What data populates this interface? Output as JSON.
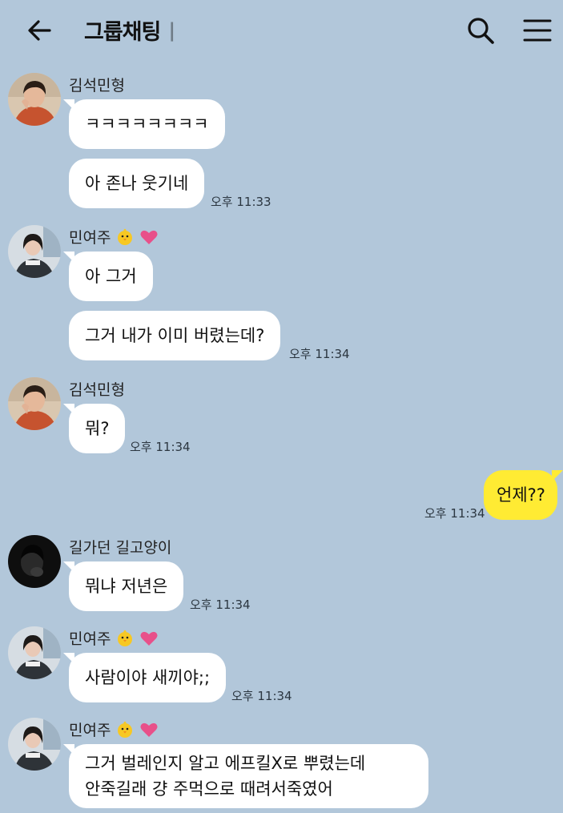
{
  "header": {
    "title": "그룹채팅",
    "count": "|",
    "back_icon": "arrow-left-icon",
    "search_icon": "search-icon",
    "menu_icon": "hamburger-menu-icon"
  },
  "colors": {
    "background": "#b2c7da",
    "incoming_bubble": "#ffffff",
    "outgoing_bubble": "#ffeb33",
    "heart": "#e8508a"
  },
  "messages": [
    {
      "sender": "김석민형",
      "texts": [
        "ㅋㅋㅋㅋㅋㅋㅋㅋ",
        "아 존나 웃기네"
      ],
      "time": "오후 11:33"
    },
    {
      "sender": "민여주",
      "sender_emoji": [
        "chick-icon",
        "heart-icon"
      ],
      "texts": [
        "아 그거",
        "그거 내가 이미 버렸는데?"
      ],
      "time": "오후 11:34"
    },
    {
      "sender": "김석민형",
      "texts": [
        "뭐?"
      ],
      "time": "오후 11:34"
    },
    {
      "sender": "me",
      "texts": [
        "언제??"
      ],
      "time": "오후 11:34"
    },
    {
      "sender": "길가던 길고양이",
      "texts": [
        "뭐냐 저년은"
      ],
      "time": "오후 11:34"
    },
    {
      "sender": "민여주",
      "sender_emoji": [
        "chick-icon",
        "heart-icon"
      ],
      "texts": [
        "사람이야 새끼야;;"
      ],
      "time": "오후 11:34"
    },
    {
      "sender": "민여주",
      "sender_emoji": [
        "chick-icon",
        "heart-icon"
      ],
      "texts": [
        "그거 벌레인지 알고 에프킬X로 뿌렸는데",
        "안죽길래 걍 주먹으로 때려서죽였어"
      ]
    }
  ]
}
